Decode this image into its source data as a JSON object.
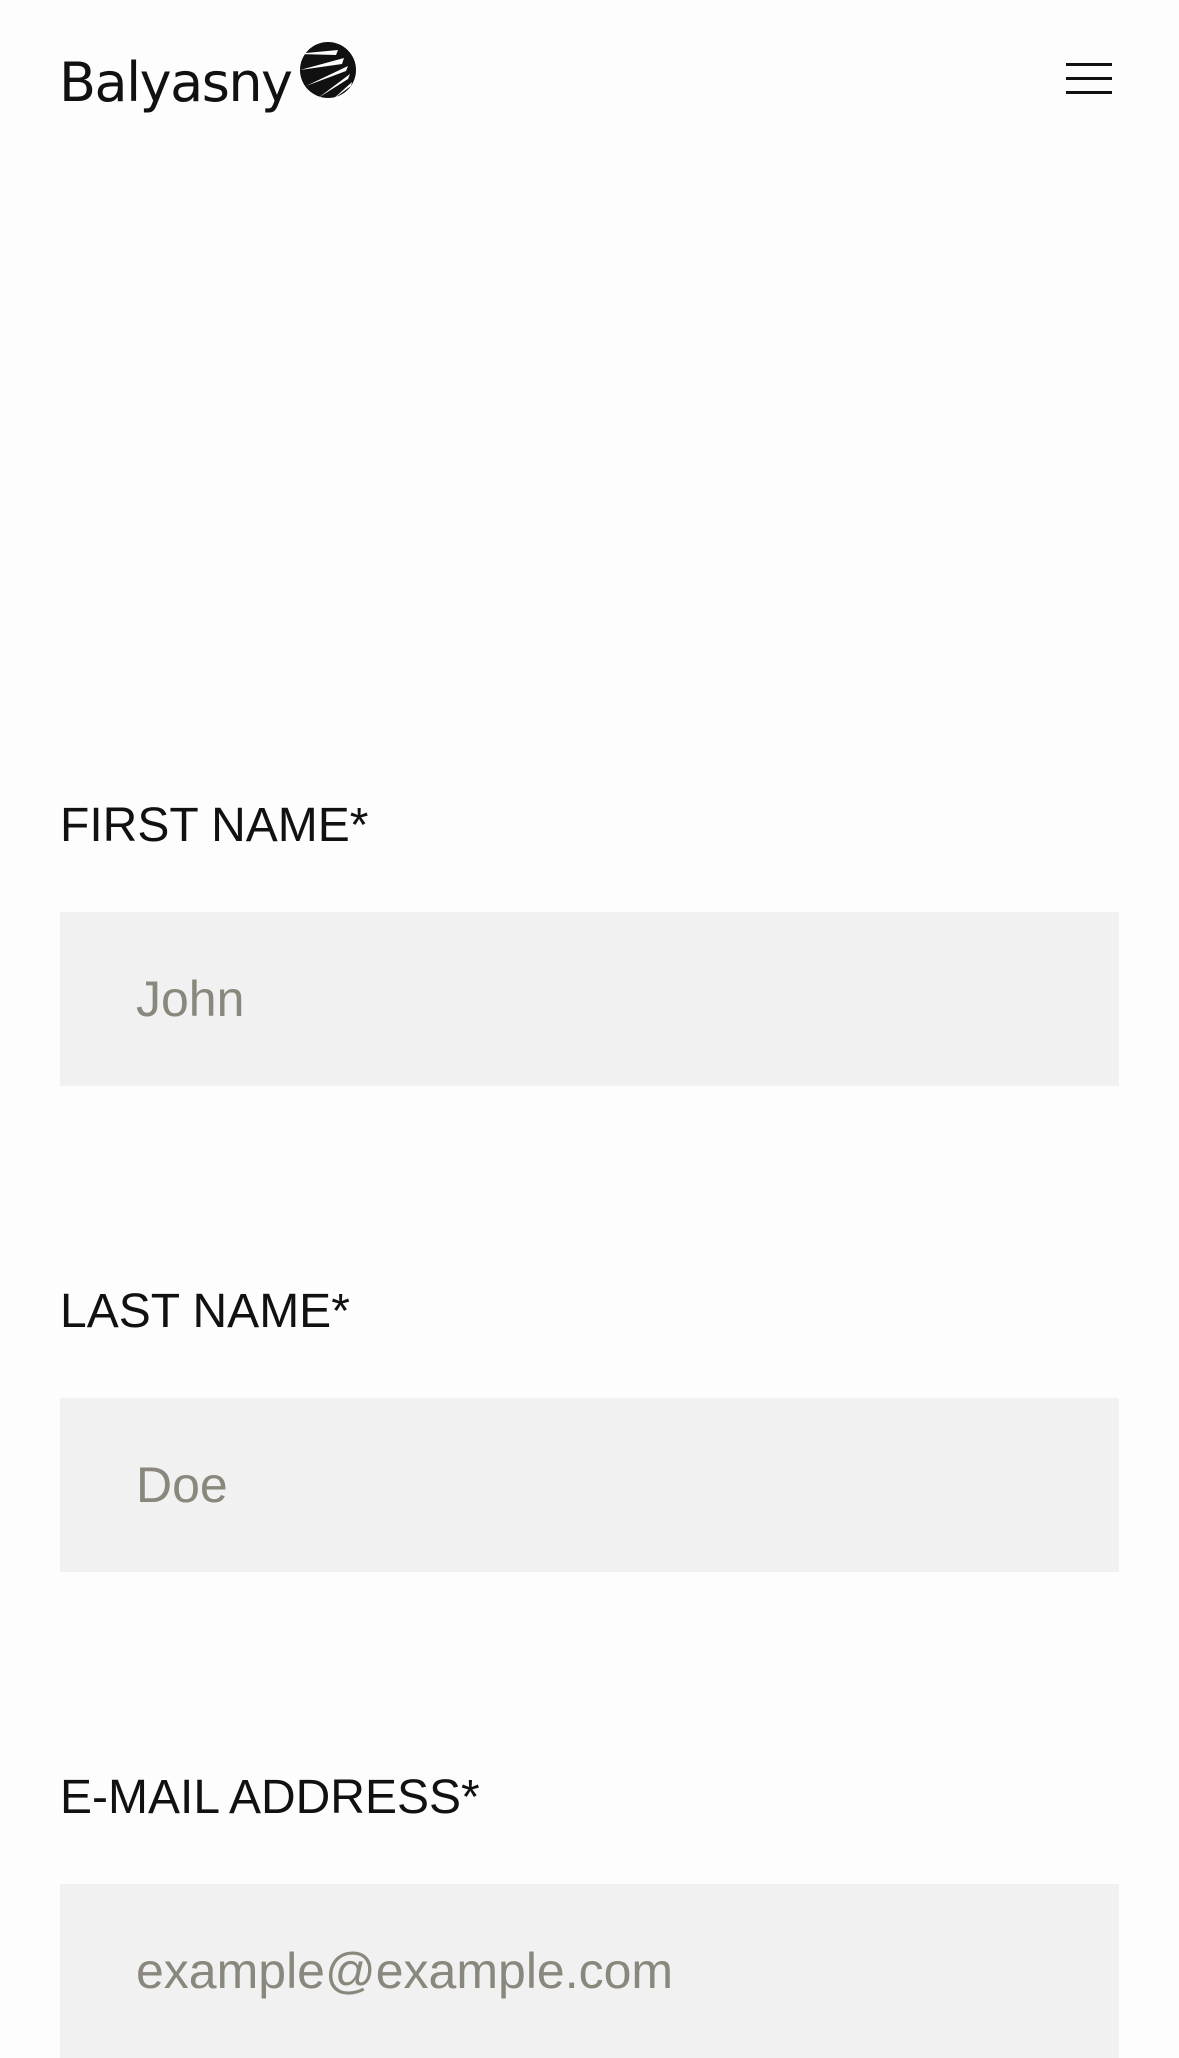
{
  "header": {
    "logo_text": "Balyasny",
    "logo_icon": "balyasny-sail-mark",
    "menu_icon": "hamburger-menu-icon"
  },
  "form": {
    "fields": [
      {
        "label": "FIRST NAME*",
        "placeholder": "John",
        "value": ""
      },
      {
        "label": "LAST NAME*",
        "placeholder": "Doe",
        "value": ""
      },
      {
        "label": "E-MAIL ADDRESS*",
        "placeholder": "example@example.com",
        "value": ""
      }
    ]
  },
  "colors": {
    "background": "#fdfdfd",
    "text": "#111111",
    "input_background": "#f1f1f1",
    "placeholder": "#8a877d"
  }
}
